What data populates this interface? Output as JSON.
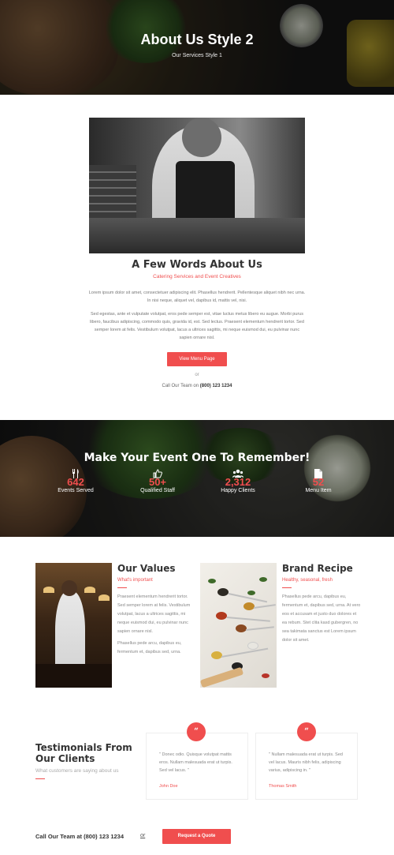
{
  "hero": {
    "title": "About Us Style 2",
    "subtitle": "Our Services Style 1"
  },
  "about": {
    "title": "A Few Words About Us",
    "subtitle": "Catering Services and Event Creatives",
    "paragraph1": "Lorem ipsum dolor sit amet, consectetuer adipiscing elit. Phasellus hendrerit. Pellentesque aliquet nibh nec urna. In nisi neque, aliquet vel, dapibus id, mattis vel, nisi.",
    "paragraph2": "Sed egestas, ante et vulputate volutpat, eros pede semper est, vitae luctus metus libero eu augue. Morbi purus libero, faucibus adipiscing, commodo quis, gravida id, est. Sed lectus. Praesent elementum hendrerit tortor. Sed semper lorem at felis. Vestibulum volutpat, lacus a ultrices sagittis, mi neque euismod dui, eu pulvinar nunc sapien ornare nisl.",
    "button_label": "View Menu Page",
    "or_text": "or",
    "call_prefix": "Call Our Team on",
    "phone": "(800) 123 1234"
  },
  "stats_band": {
    "title": "Make Your Event One To Remember!",
    "stats": [
      {
        "icon": "cutlery-icon",
        "value": "642",
        "label": "Events Served"
      },
      {
        "icon": "thumbs-up-icon",
        "value": "50+",
        "label": "Qualified Staff"
      },
      {
        "icon": "users-icon",
        "value": "2,312",
        "label": "Happy Clients"
      },
      {
        "icon": "document-icon",
        "value": "52",
        "label": "Menu Item"
      }
    ]
  },
  "values": {
    "title": "Our Values",
    "subtitle": "What's important",
    "text1": "Praesent elementum hendrerit tortor. Sed semper lorem at felis. Vestibulum volutpat, lacus a ultrices sagittis, mi neque euismod dui, eu pulvinar nunc sapien ornare nisl.",
    "text2": "Phasellus pede arcu, dapibus eu, fermentum et, dapibus sed, urna."
  },
  "recipe": {
    "title": "Brand Recipe",
    "subtitle": "Healthy, seasonal, fresh",
    "text1": "Phasellus pede arcu, dapibus eu, fermentum et, dapibus sed, urna. At vero eos et accusam et justo duo dolores et ea rebum. Stet clita kasd gubergren, no sea takimata sanctus est Lorem ipsum dolor sit amet."
  },
  "testimonials": {
    "title": "Testimonials From Our Clients",
    "subtitle": "What customers are saying about us",
    "items": [
      {
        "quote": "\" Donec odio. Quisque volutpat mattis eros. Nullam malesuada erat ut turpis. Sed vel lacus. \"",
        "name": "John Doe"
      },
      {
        "quote": "\" Nullam malesuada erat ut turpis. Sed vel lacus. Mauris nibh felis, adipiscing varius, adipiscing in. \"",
        "name": "Thomas Smith"
      }
    ]
  },
  "footer_cta": {
    "call_text": "Call Our Team at (800) 123 1234",
    "or_text": "or",
    "button_label": "Request a Quote"
  },
  "colors": {
    "accent": "#f04e4e",
    "heading": "#333333",
    "body_text": "#888888"
  }
}
